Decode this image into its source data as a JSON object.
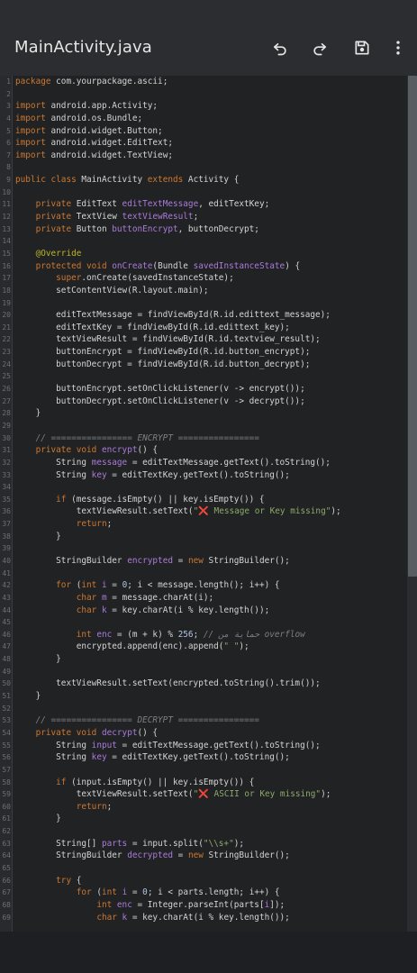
{
  "app": {
    "title": "MainActivity.java",
    "icons": [
      "undo-icon",
      "redo-icon",
      "save-icon",
      "more-vert-icon"
    ]
  },
  "editor": {
    "lines": [
      [
        [
          "kw",
          "package"
        ],
        [
          "pl",
          " com.yourpackage.ascii;"
        ]
      ],
      [],
      [
        [
          "kw",
          "import"
        ],
        [
          "pl",
          " android.app.Activity;"
        ]
      ],
      [
        [
          "kw",
          "import"
        ],
        [
          "pl",
          " android.os.Bundle;"
        ]
      ],
      [
        [
          "kw",
          "import"
        ],
        [
          "pl",
          " android.widget.Button;"
        ]
      ],
      [
        [
          "kw",
          "import"
        ],
        [
          "pl",
          " android.widget.EditText;"
        ]
      ],
      [
        [
          "kw",
          "import"
        ],
        [
          "pl",
          " android.widget.TextView;"
        ]
      ],
      [],
      [
        [
          "kw",
          "public class"
        ],
        [
          "pl",
          " MainActivity "
        ],
        [
          "kw",
          "extends"
        ],
        [
          "pl",
          " Activity {"
        ]
      ],
      [],
      [
        [
          "pl",
          "    "
        ],
        [
          "kw",
          "private"
        ],
        [
          "pl",
          " EditText "
        ],
        [
          "fn",
          "editTextMessage"
        ],
        [
          "pl",
          ", editTextKey;"
        ]
      ],
      [
        [
          "pl",
          "    "
        ],
        [
          "kw",
          "private"
        ],
        [
          "pl",
          " TextView "
        ],
        [
          "fn",
          "textViewResult"
        ],
        [
          "pl",
          ";"
        ]
      ],
      [
        [
          "pl",
          "    "
        ],
        [
          "kw",
          "private"
        ],
        [
          "pl",
          " Button "
        ],
        [
          "fn",
          "buttonEncrypt"
        ],
        [
          "pl",
          ", buttonDecrypt;"
        ]
      ],
      [],
      [
        [
          "pl",
          "    "
        ],
        [
          "ann",
          "@Override"
        ]
      ],
      [
        [
          "pl",
          "    "
        ],
        [
          "kw",
          "protected void"
        ],
        [
          "pl",
          " "
        ],
        [
          "fn",
          "onCreate"
        ],
        [
          "pl",
          "(Bundle "
        ],
        [
          "fn",
          "savedInstanceState"
        ],
        [
          "pl",
          ") {"
        ]
      ],
      [
        [
          "pl",
          "        "
        ],
        [
          "kw",
          "super"
        ],
        [
          "pl",
          ".onCreate(savedInstanceState);"
        ]
      ],
      [
        [
          "pl",
          "        setContentView(R.layout.main);"
        ]
      ],
      [],
      [
        [
          "pl",
          "        editTextMessage = findViewById(R.id.edittext_message);"
        ]
      ],
      [
        [
          "pl",
          "        editTextKey = findViewById(R.id.edittext_key);"
        ]
      ],
      [
        [
          "pl",
          "        textViewResult = findViewById(R.id.textview_result);"
        ]
      ],
      [
        [
          "pl",
          "        buttonEncrypt = findViewById(R.id.button_encrypt);"
        ]
      ],
      [
        [
          "pl",
          "        buttonDecrypt = findViewById(R.id.button_decrypt);"
        ]
      ],
      [],
      [
        [
          "pl",
          "        buttonEncrypt.setOnClickListener(v -> encrypt());"
        ]
      ],
      [
        [
          "pl",
          "        buttonDecrypt.setOnClickListener(v -> decrypt());"
        ]
      ],
      [
        [
          "pl",
          "    }"
        ]
      ],
      [],
      [
        [
          "pl",
          "    "
        ],
        [
          "cm",
          "// ================ ENCRYPT ================"
        ]
      ],
      [
        [
          "pl",
          "    "
        ],
        [
          "kw",
          "private void"
        ],
        [
          "pl",
          " "
        ],
        [
          "fn",
          "encrypt"
        ],
        [
          "pl",
          "() {"
        ]
      ],
      [
        [
          "pl",
          "        String "
        ],
        [
          "fn",
          "message"
        ],
        [
          "pl",
          " = editTextMessage.getText().toString();"
        ]
      ],
      [
        [
          "pl",
          "        String "
        ],
        [
          "fn",
          "key"
        ],
        [
          "pl",
          " = editTextKey.getText().toString();"
        ]
      ],
      [],
      [
        [
          "pl",
          "        "
        ],
        [
          "kw",
          "if"
        ],
        [
          "pl",
          " (message.isEmpty() || key.isEmpty()) {"
        ]
      ],
      [
        [
          "pl",
          "            textViewResult.setText("
        ],
        [
          "str",
          "\""
        ],
        [
          "x",
          "❌"
        ],
        [
          "str",
          " Message or Key missing\""
        ],
        [
          "pl",
          ");"
        ]
      ],
      [
        [
          "pl",
          "            "
        ],
        [
          "kw",
          "return"
        ],
        [
          "pl",
          ";"
        ]
      ],
      [
        [
          "pl",
          "        }"
        ]
      ],
      [],
      [
        [
          "pl",
          "        StringBuilder "
        ],
        [
          "fn",
          "encrypted"
        ],
        [
          "pl",
          " = "
        ],
        [
          "kw",
          "new"
        ],
        [
          "pl",
          " StringBuilder();"
        ]
      ],
      [],
      [
        [
          "pl",
          "        "
        ],
        [
          "kw",
          "for"
        ],
        [
          "pl",
          " ("
        ],
        [
          "kw",
          "int"
        ],
        [
          "pl",
          " "
        ],
        [
          "fn",
          "i"
        ],
        [
          "pl",
          " = "
        ],
        [
          "num",
          "0"
        ],
        [
          "pl",
          "; i < message.length(); i++) {"
        ]
      ],
      [
        [
          "pl",
          "            "
        ],
        [
          "kw",
          "char"
        ],
        [
          "pl",
          " "
        ],
        [
          "fn",
          "m"
        ],
        [
          "pl",
          " = message.charAt(i);"
        ]
      ],
      [
        [
          "pl",
          "            "
        ],
        [
          "kw",
          "char"
        ],
        [
          "pl",
          " "
        ],
        [
          "fn",
          "k"
        ],
        [
          "pl",
          " = key.charAt(i % key.length());"
        ]
      ],
      [],
      [
        [
          "pl",
          "            "
        ],
        [
          "kw",
          "int"
        ],
        [
          "pl",
          " "
        ],
        [
          "fn",
          "enc"
        ],
        [
          "pl",
          " = (m + k) % "
        ],
        [
          "num",
          "256"
        ],
        [
          "pl",
          "; "
        ],
        [
          "cm",
          "// حماية من overflow"
        ]
      ],
      [
        [
          "pl",
          "            encrypted.append(enc).append("
        ],
        [
          "str",
          "\" \""
        ],
        [
          "pl",
          ");"
        ]
      ],
      [
        [
          "pl",
          "        }"
        ]
      ],
      [],
      [
        [
          "pl",
          "        textViewResult.setText(encrypted.toString().trim());"
        ]
      ],
      [
        [
          "pl",
          "    }"
        ]
      ],
      [],
      [
        [
          "pl",
          "    "
        ],
        [
          "cm",
          "// ================ DECRYPT ================"
        ]
      ],
      [
        [
          "pl",
          "    "
        ],
        [
          "kw",
          "private void"
        ],
        [
          "pl",
          " "
        ],
        [
          "fn",
          "decrypt"
        ],
        [
          "pl",
          "() {"
        ]
      ],
      [
        [
          "pl",
          "        String "
        ],
        [
          "fn",
          "input"
        ],
        [
          "pl",
          " = editTextMessage.getText().toString();"
        ]
      ],
      [
        [
          "pl",
          "        String "
        ],
        [
          "fn",
          "key"
        ],
        [
          "pl",
          " = editTextKey.getText().toString();"
        ]
      ],
      [],
      [
        [
          "pl",
          "        "
        ],
        [
          "kw",
          "if"
        ],
        [
          "pl",
          " (input.isEmpty() || key.isEmpty()) {"
        ]
      ],
      [
        [
          "pl",
          "            textViewResult.setText("
        ],
        [
          "str",
          "\""
        ],
        [
          "x",
          "❌"
        ],
        [
          "str",
          " ASCII or Key missing\""
        ],
        [
          "pl",
          ");"
        ]
      ],
      [
        [
          "pl",
          "            "
        ],
        [
          "kw",
          "return"
        ],
        [
          "pl",
          ";"
        ]
      ],
      [
        [
          "pl",
          "        }"
        ]
      ],
      [],
      [
        [
          "pl",
          "        String[] "
        ],
        [
          "fn",
          "parts"
        ],
        [
          "pl",
          " = input.split("
        ],
        [
          "str",
          "\"\\\\s+\""
        ],
        [
          "pl",
          ");"
        ]
      ],
      [
        [
          "pl",
          "        StringBuilder "
        ],
        [
          "fn",
          "decrypted"
        ],
        [
          "pl",
          " = "
        ],
        [
          "kw",
          "new"
        ],
        [
          "pl",
          " StringBuilder();"
        ]
      ],
      [],
      [
        [
          "pl",
          "        "
        ],
        [
          "kw",
          "try"
        ],
        [
          "pl",
          " {"
        ]
      ],
      [
        [
          "pl",
          "            "
        ],
        [
          "kw",
          "for"
        ],
        [
          "pl",
          " ("
        ],
        [
          "kw",
          "int"
        ],
        [
          "pl",
          " "
        ],
        [
          "fn",
          "i"
        ],
        [
          "pl",
          " = "
        ],
        [
          "num",
          "0"
        ],
        [
          "pl",
          "; i < parts.length; i++) {"
        ]
      ],
      [
        [
          "pl",
          "                "
        ],
        [
          "kw",
          "int"
        ],
        [
          "pl",
          " "
        ],
        [
          "fn",
          "enc"
        ],
        [
          "pl",
          " = Integer.parseInt(parts["
        ],
        [
          "fn",
          "i"
        ],
        [
          "pl",
          "]);"
        ]
      ],
      [
        [
          "pl",
          "                "
        ],
        [
          "kw",
          "char"
        ],
        [
          "pl",
          " "
        ],
        [
          "fn",
          "k"
        ],
        [
          "pl",
          " = key.charAt(i % key.length());"
        ]
      ]
    ]
  },
  "colors": {
    "appbar": "#2b2d30",
    "editor_bg": "#212224",
    "keyword": "#cc7832",
    "field": "#a97bd9",
    "string": "#8ba96a",
    "comment": "#7d7f85",
    "annotation": "#bbb529"
  }
}
